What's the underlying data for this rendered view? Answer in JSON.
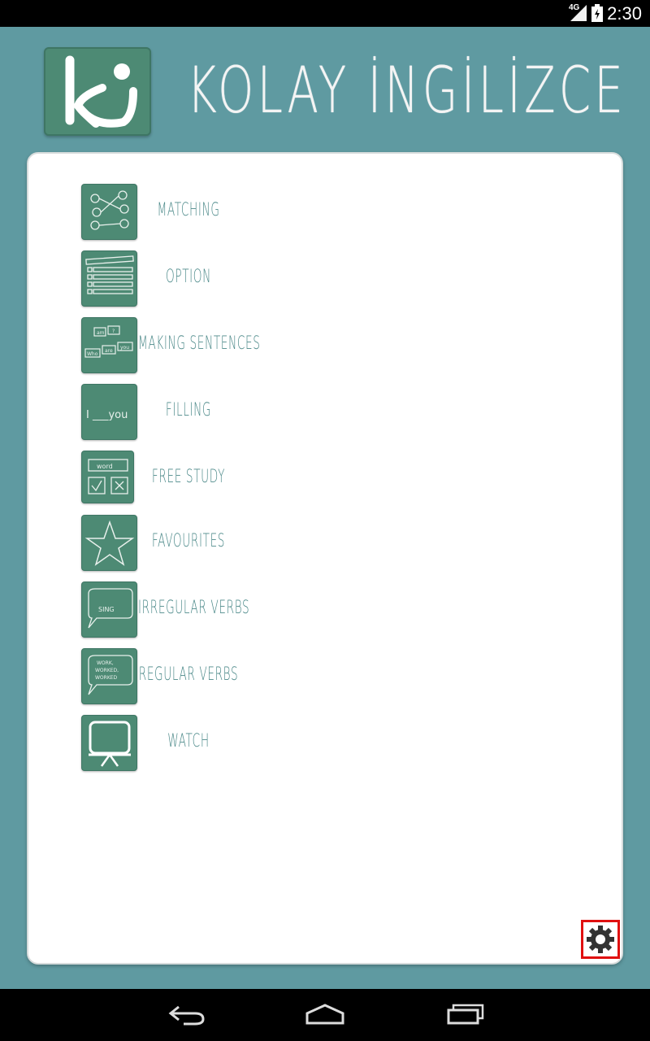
{
  "status_bar": {
    "time": "2:30",
    "network": "4G",
    "icons": [
      "signal-icon",
      "battery-icon"
    ]
  },
  "header": {
    "logo_text": "ki",
    "title": "KOLAY İNGİLİZCE"
  },
  "menu": {
    "items": [
      {
        "label": "MATCHING",
        "icon": "matching-icon"
      },
      {
        "label": "OPTION",
        "icon": "option-icon"
      },
      {
        "label": "MAKING SENTENCES",
        "icon": "making-sentences-icon",
        "icon_words": [
          "am",
          "?",
          "Who",
          "are",
          "you"
        ]
      },
      {
        "label": "FILLING",
        "icon": "filling-icon",
        "icon_text": "I ___you"
      },
      {
        "label": "FREE STUDY",
        "icon": "free-study-icon",
        "icon_text": "word"
      },
      {
        "label": "FAVOURITES",
        "icon": "star-icon"
      },
      {
        "label": "IRREGULAR VERBS",
        "icon": "irregular-verbs-icon",
        "icon_text": "SING"
      },
      {
        "label": "REGULAR VERBS",
        "icon": "regular-verbs-icon",
        "icon_lines": [
          "WORK,",
          "WORKED,",
          "WORKED"
        ]
      },
      {
        "label": "WATCH",
        "icon": "watch-icon"
      }
    ]
  },
  "settings": {
    "icon": "gear-icon"
  },
  "nav_bar": {
    "icons": [
      "back-icon",
      "home-icon",
      "recent-apps-icon"
    ]
  },
  "colors": {
    "background": "#5f9aa1",
    "icon_tile": "#4d8a74",
    "label_text": "#4d8a8a",
    "highlight": "#e01010"
  }
}
